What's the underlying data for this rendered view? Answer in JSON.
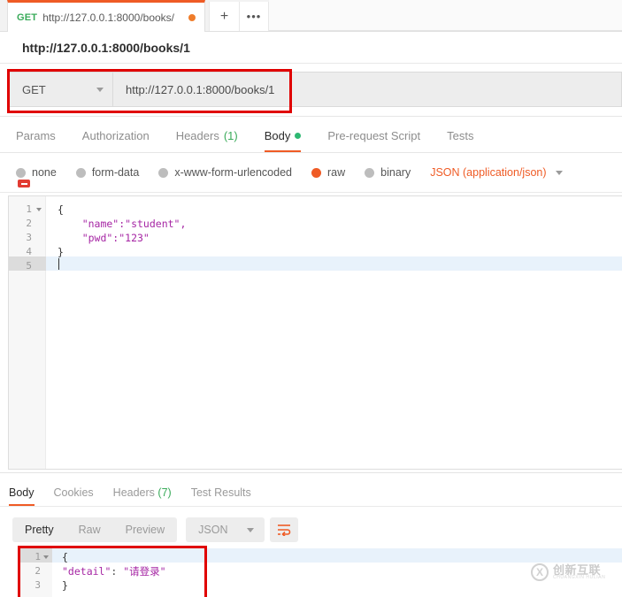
{
  "tab": {
    "method": "GET",
    "url_short": "http://127.0.0.1:8000/books/",
    "unsaved_icon": "unsaved-dot",
    "new_tab_icon": "+",
    "more_icon": "•••"
  },
  "request_name": "http://127.0.0.1:8000/books/1",
  "urlbar": {
    "method": "GET",
    "url": "http://127.0.0.1:8000/books/1",
    "caret_icon": "chevron-down-icon"
  },
  "request_tabs": [
    {
      "label": "Params",
      "active": false
    },
    {
      "label": "Authorization",
      "active": false
    },
    {
      "label": "Headers",
      "count": "(1)",
      "active": false
    },
    {
      "label": "Body",
      "active": true,
      "dot": true
    },
    {
      "label": "Pre-request Script",
      "active": false
    },
    {
      "label": "Tests",
      "active": false
    }
  ],
  "body_types": [
    {
      "label": "none",
      "selected": false
    },
    {
      "label": "form-data",
      "selected": false
    },
    {
      "label": "x-www-form-urlencoded",
      "selected": false
    },
    {
      "label": "raw",
      "selected": true
    },
    {
      "label": "binary",
      "selected": false
    }
  ],
  "body_format": "JSON (application/json)",
  "request_body": {
    "lines": [
      {
        "no": "1",
        "text": "{",
        "fold": true
      },
      {
        "no": "2",
        "text": "    \"name\":\"student\","
      },
      {
        "no": "3",
        "text": "    \"pwd\":\"123\""
      },
      {
        "no": "4",
        "text": "}"
      },
      {
        "no": "5",
        "text": "",
        "active": true
      }
    ]
  },
  "response_tabs": [
    {
      "label": "Body",
      "active": true
    },
    {
      "label": "Cookies",
      "active": false
    },
    {
      "label": "Headers",
      "count": "(7)",
      "active": false
    },
    {
      "label": "Test Results",
      "active": false
    }
  ],
  "response_toolbar": {
    "views": [
      {
        "label": "Pretty",
        "active": true
      },
      {
        "label": "Raw",
        "active": false
      },
      {
        "label": "Preview",
        "active": false
      }
    ],
    "format": "JSON",
    "wrap_icon": "word-wrap-icon"
  },
  "response_body": {
    "lines": [
      {
        "no": "1",
        "text": "{",
        "fold": true,
        "active": true
      },
      {
        "no": "2",
        "key": "\"detail\"",
        "sep": ": ",
        "value": "\"请登录\""
      },
      {
        "no": "3",
        "text": "}"
      }
    ]
  },
  "annotations": {
    "url_box_color": "#e00000",
    "response_box_color": "#e00000"
  },
  "watermark": {
    "mark": "X",
    "cn": "创新互联",
    "en": "CHUANGXIN HULIAN"
  },
  "colors": {
    "accent": "#ef5b25",
    "method_green": "#3aab5a",
    "json_key": "#a626a4"
  }
}
